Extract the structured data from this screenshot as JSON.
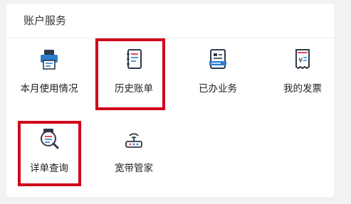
{
  "panel": {
    "title": "账户服务"
  },
  "services": [
    {
      "label": "本月使用情况",
      "icon": "printer-doc-icon"
    },
    {
      "label": "历史账单",
      "icon": "notebook-icon"
    },
    {
      "label": "已办业务",
      "icon": "business-card-icon"
    },
    {
      "label": "我的发票",
      "icon": "invoice-yen-icon"
    },
    {
      "label": "详单查询",
      "icon": "magnifier-doc-icon"
    },
    {
      "label": "宽带管家",
      "icon": "router-icon"
    }
  ],
  "highlights": [
    "历史账单",
    "详单查询"
  ],
  "colors": {
    "highlight": "#d0021b",
    "icon_blue": "#2d7dd2",
    "icon_red": "#e84c5c",
    "icon_dark": "#2f3a4a"
  }
}
